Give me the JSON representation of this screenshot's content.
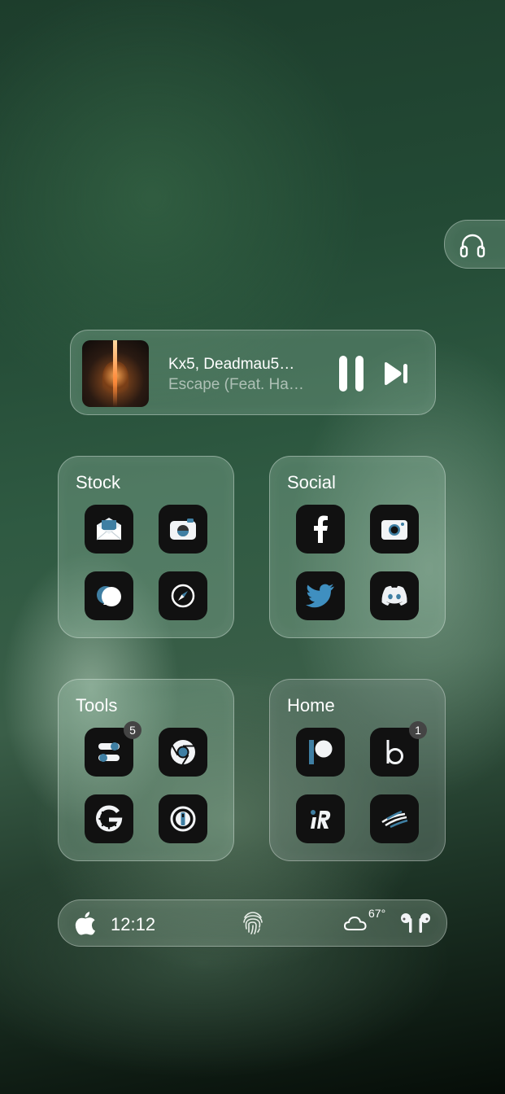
{
  "headphone_widget": {
    "icon": "headphones-icon"
  },
  "now_playing": {
    "artist": "Kx5, Deadmau5…",
    "song": "Escape (Feat. Ha…",
    "album_art": "album-art",
    "controls": [
      "pause",
      "next-track"
    ]
  },
  "folders": [
    {
      "title": "Stock",
      "apps": [
        "mail-icon",
        "camera-icon",
        "messages-icon",
        "safari-compass-icon"
      ]
    },
    {
      "title": "Social",
      "apps": [
        "facebook-icon",
        "instagram-icon",
        "twitter-icon",
        "discord-icon"
      ]
    },
    {
      "title": "Tools",
      "apps": [
        "toggles-icon",
        "chrome-icon",
        "google-icon",
        "onepassword-icon"
      ],
      "badges": {
        "toggles-icon": "5"
      }
    },
    {
      "title": "Home",
      "apps": [
        "patreon-icon",
        "b-app-icon",
        "ir-app-icon",
        "bank-of-america-icon"
      ],
      "badges": {
        "b-app-icon": "1"
      }
    }
  ],
  "dock": {
    "time": "12:12",
    "temperature": "67°",
    "icons": [
      "apple-icon",
      "fingerprint-icon",
      "cloud-icon",
      "airpods-icon"
    ]
  },
  "colors": {
    "accent_blue": "#3f7fa3",
    "app_bg": "#111111"
  }
}
